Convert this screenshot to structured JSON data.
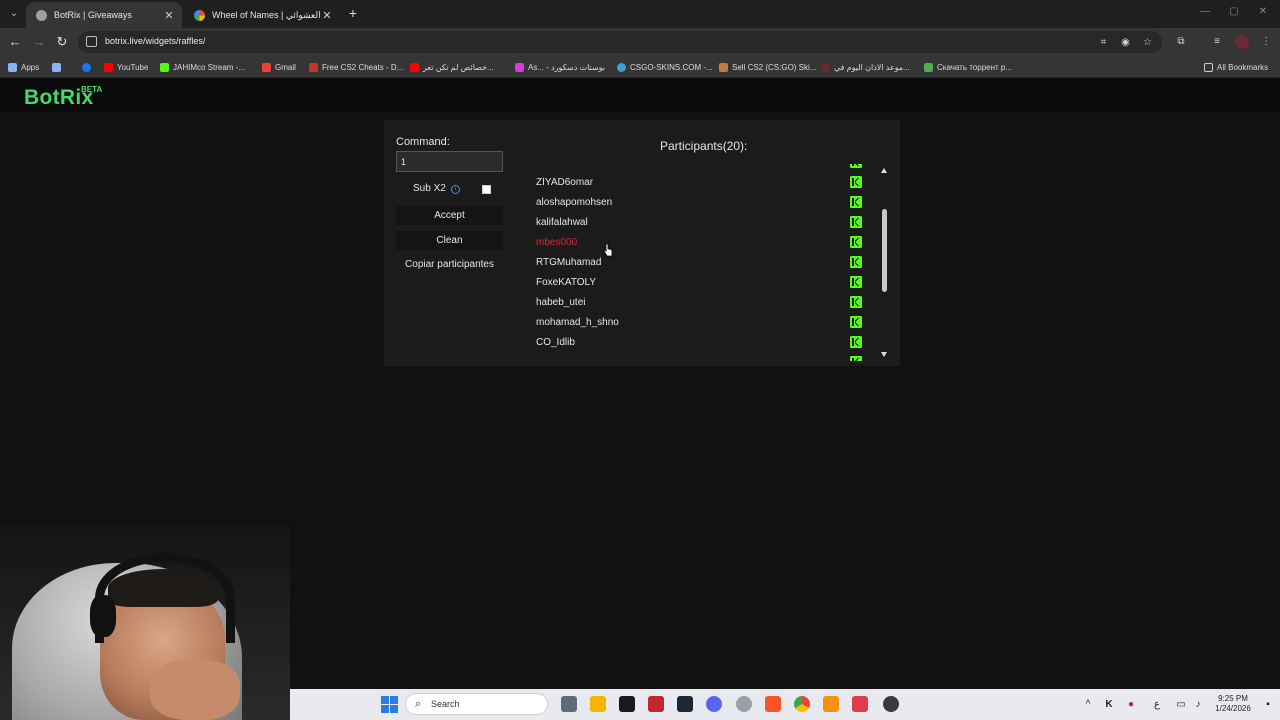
{
  "browser": {
    "tabs": [
      {
        "title": "BotRix | Giveaways",
        "favicon_color": "#9aa0a6"
      },
      {
        "title": "Wheel of Names | سم العشوائي",
        "favicon_color": "#e8453c"
      }
    ],
    "url": "botrix.live/widgets/raffles/",
    "bookmarks": [
      {
        "label": "Apps",
        "color": "#8ab4f8"
      },
      {
        "label": "",
        "color": "#8ab4f8"
      },
      {
        "label": "",
        "color": "#1877f2"
      },
      {
        "label": "YouTube",
        "color": "#ff0000"
      },
      {
        "label": "JAHIMco Stream -...",
        "color": "#53fc18"
      },
      {
        "label": "Gmail",
        "color": "#ea4335"
      },
      {
        "label": "Free CS2 Cheats - D...",
        "color": "#c0392b"
      },
      {
        "label": "خصائص لم تكن تعر...",
        "color": "#ff0000"
      },
      {
        "label": "As... - بوستات دسكورد",
        "color": "#d63ad9"
      },
      {
        "label": "CSGO-SKINS.COM -...",
        "color": "#3aa0d6"
      },
      {
        "label": "Sell CS2 (CS:GO) Ski...",
        "color": "#c07a3a"
      },
      {
        "label": "موعد الاذان اليوم في...",
        "color": "#6b2a2a"
      },
      {
        "label": "Скачать торрент р...",
        "color": "#4caf50"
      },
      {
        "label": "All Bookmarks",
        "color": "#cccccc"
      }
    ]
  },
  "site": {
    "logo": "BotRix",
    "logo_badge": "BETA"
  },
  "raffle": {
    "command_label": "Command:",
    "command_value": "1",
    "sub_label": "Sub X2",
    "sub_checked": false,
    "accept_label": "Accept",
    "clean_label": "Clean",
    "copy_label": "Copiar participantes",
    "participants_title": "Participants(20):",
    "participants": [
      {
        "name": "ZIYAD6omar",
        "highlight": false
      },
      {
        "name": "aloshapomohsen",
        "highlight": false
      },
      {
        "name": "kalifalahwal",
        "highlight": false
      },
      {
        "name": "mbes000",
        "highlight": true
      },
      {
        "name": "RTGMuhamad",
        "highlight": false
      },
      {
        "name": "FoxeKATOLY",
        "highlight": false
      },
      {
        "name": "habeb_utei",
        "highlight": false
      },
      {
        "name": "mohamad_h_shno",
        "highlight": false
      },
      {
        "name": "CO_Idlib",
        "highlight": false
      }
    ],
    "scroll_position": 0.4
  },
  "taskbar": {
    "search_placeholder": "Search",
    "time": "9:25 PM",
    "date": "1/24/2026",
    "lang": "ع"
  }
}
